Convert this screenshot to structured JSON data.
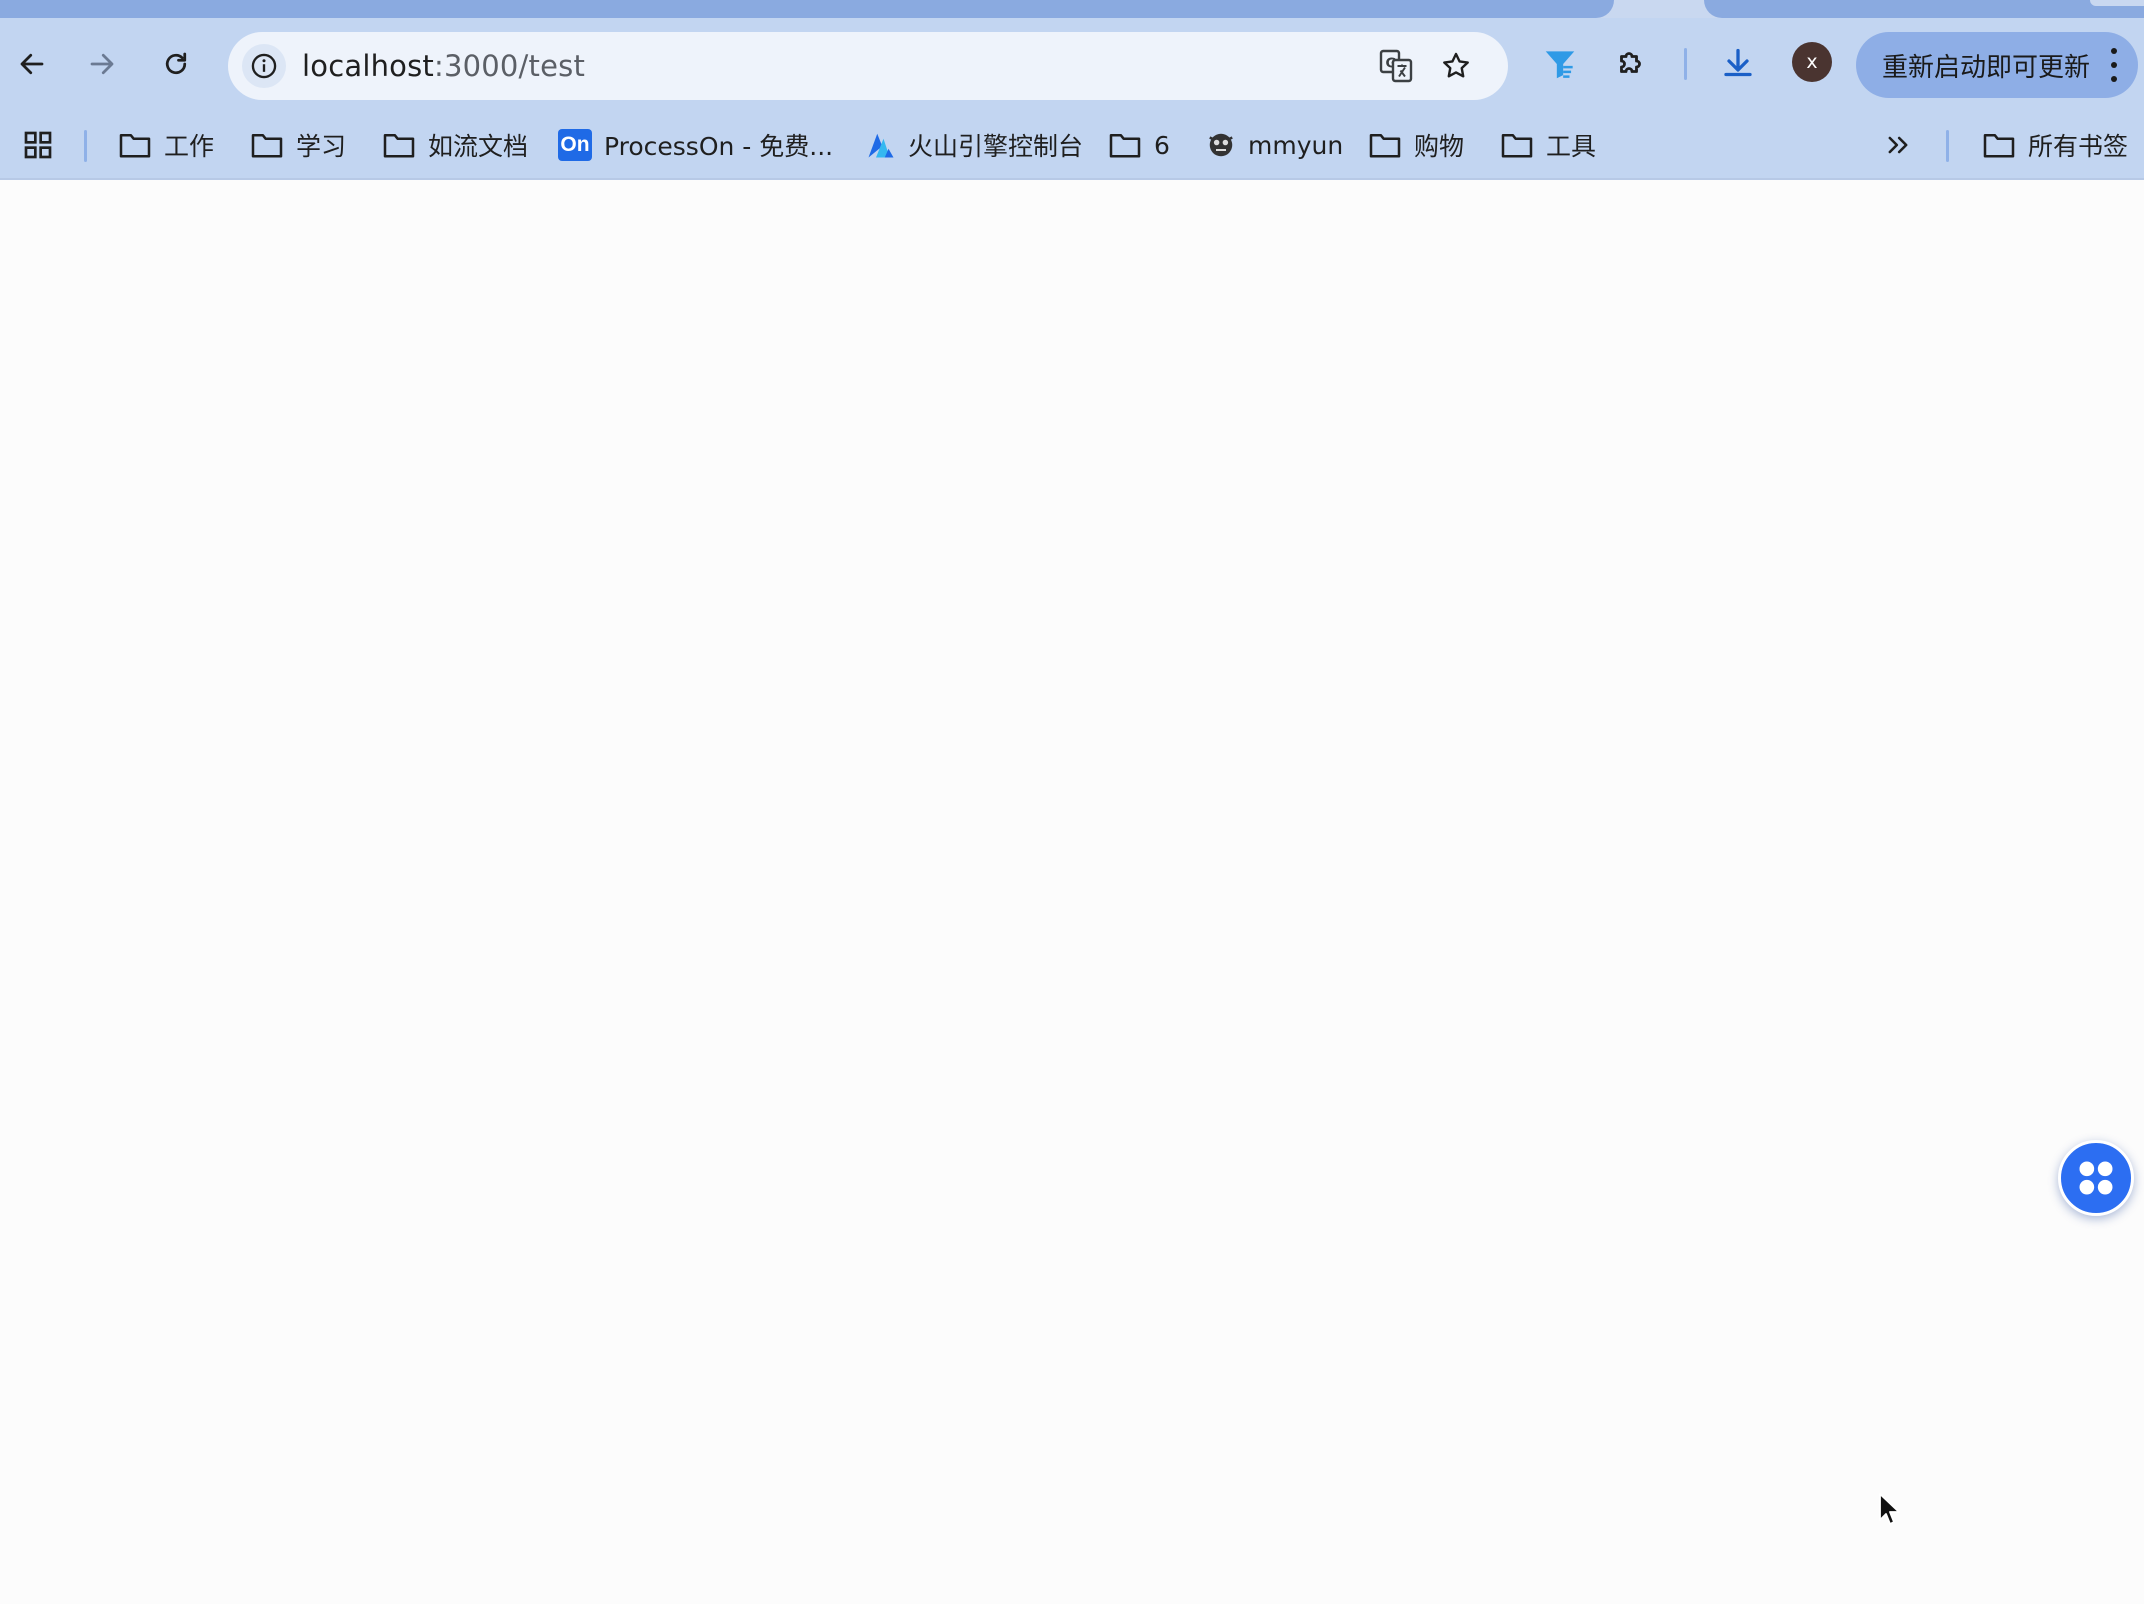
{
  "browser": {
    "address_bar": {
      "host": "localhost",
      "path": ":3000/test"
    },
    "update_button": {
      "label": "重新启动即可更新"
    },
    "profile": {
      "initial": "x",
      "color": "#4a3430"
    },
    "accent_color": "#1f6ae6"
  },
  "bookmarks": {
    "items": [
      {
        "label": "工作",
        "icon": "folder-icon"
      },
      {
        "label": "学习",
        "icon": "folder-icon"
      },
      {
        "label": "如流文档",
        "icon": "folder-icon"
      },
      {
        "label": "ProcessOn - 免费...",
        "icon": "processon-logo",
        "logo_text": "On"
      },
      {
        "label": "火山引擎控制台",
        "icon": "volcano-engine-icon"
      },
      {
        "label": "6",
        "icon": "folder-icon"
      },
      {
        "label": "mmyun",
        "icon": "mmyun-icon"
      },
      {
        "label": "购物",
        "icon": "folder-icon"
      },
      {
        "label": "工具",
        "icon": "folder-icon"
      }
    ],
    "all_bookmarks_label": "所有书签"
  },
  "page": {
    "fab_icon": "four-leaf-grid-icon",
    "fab_color": "#2c6ef2"
  }
}
